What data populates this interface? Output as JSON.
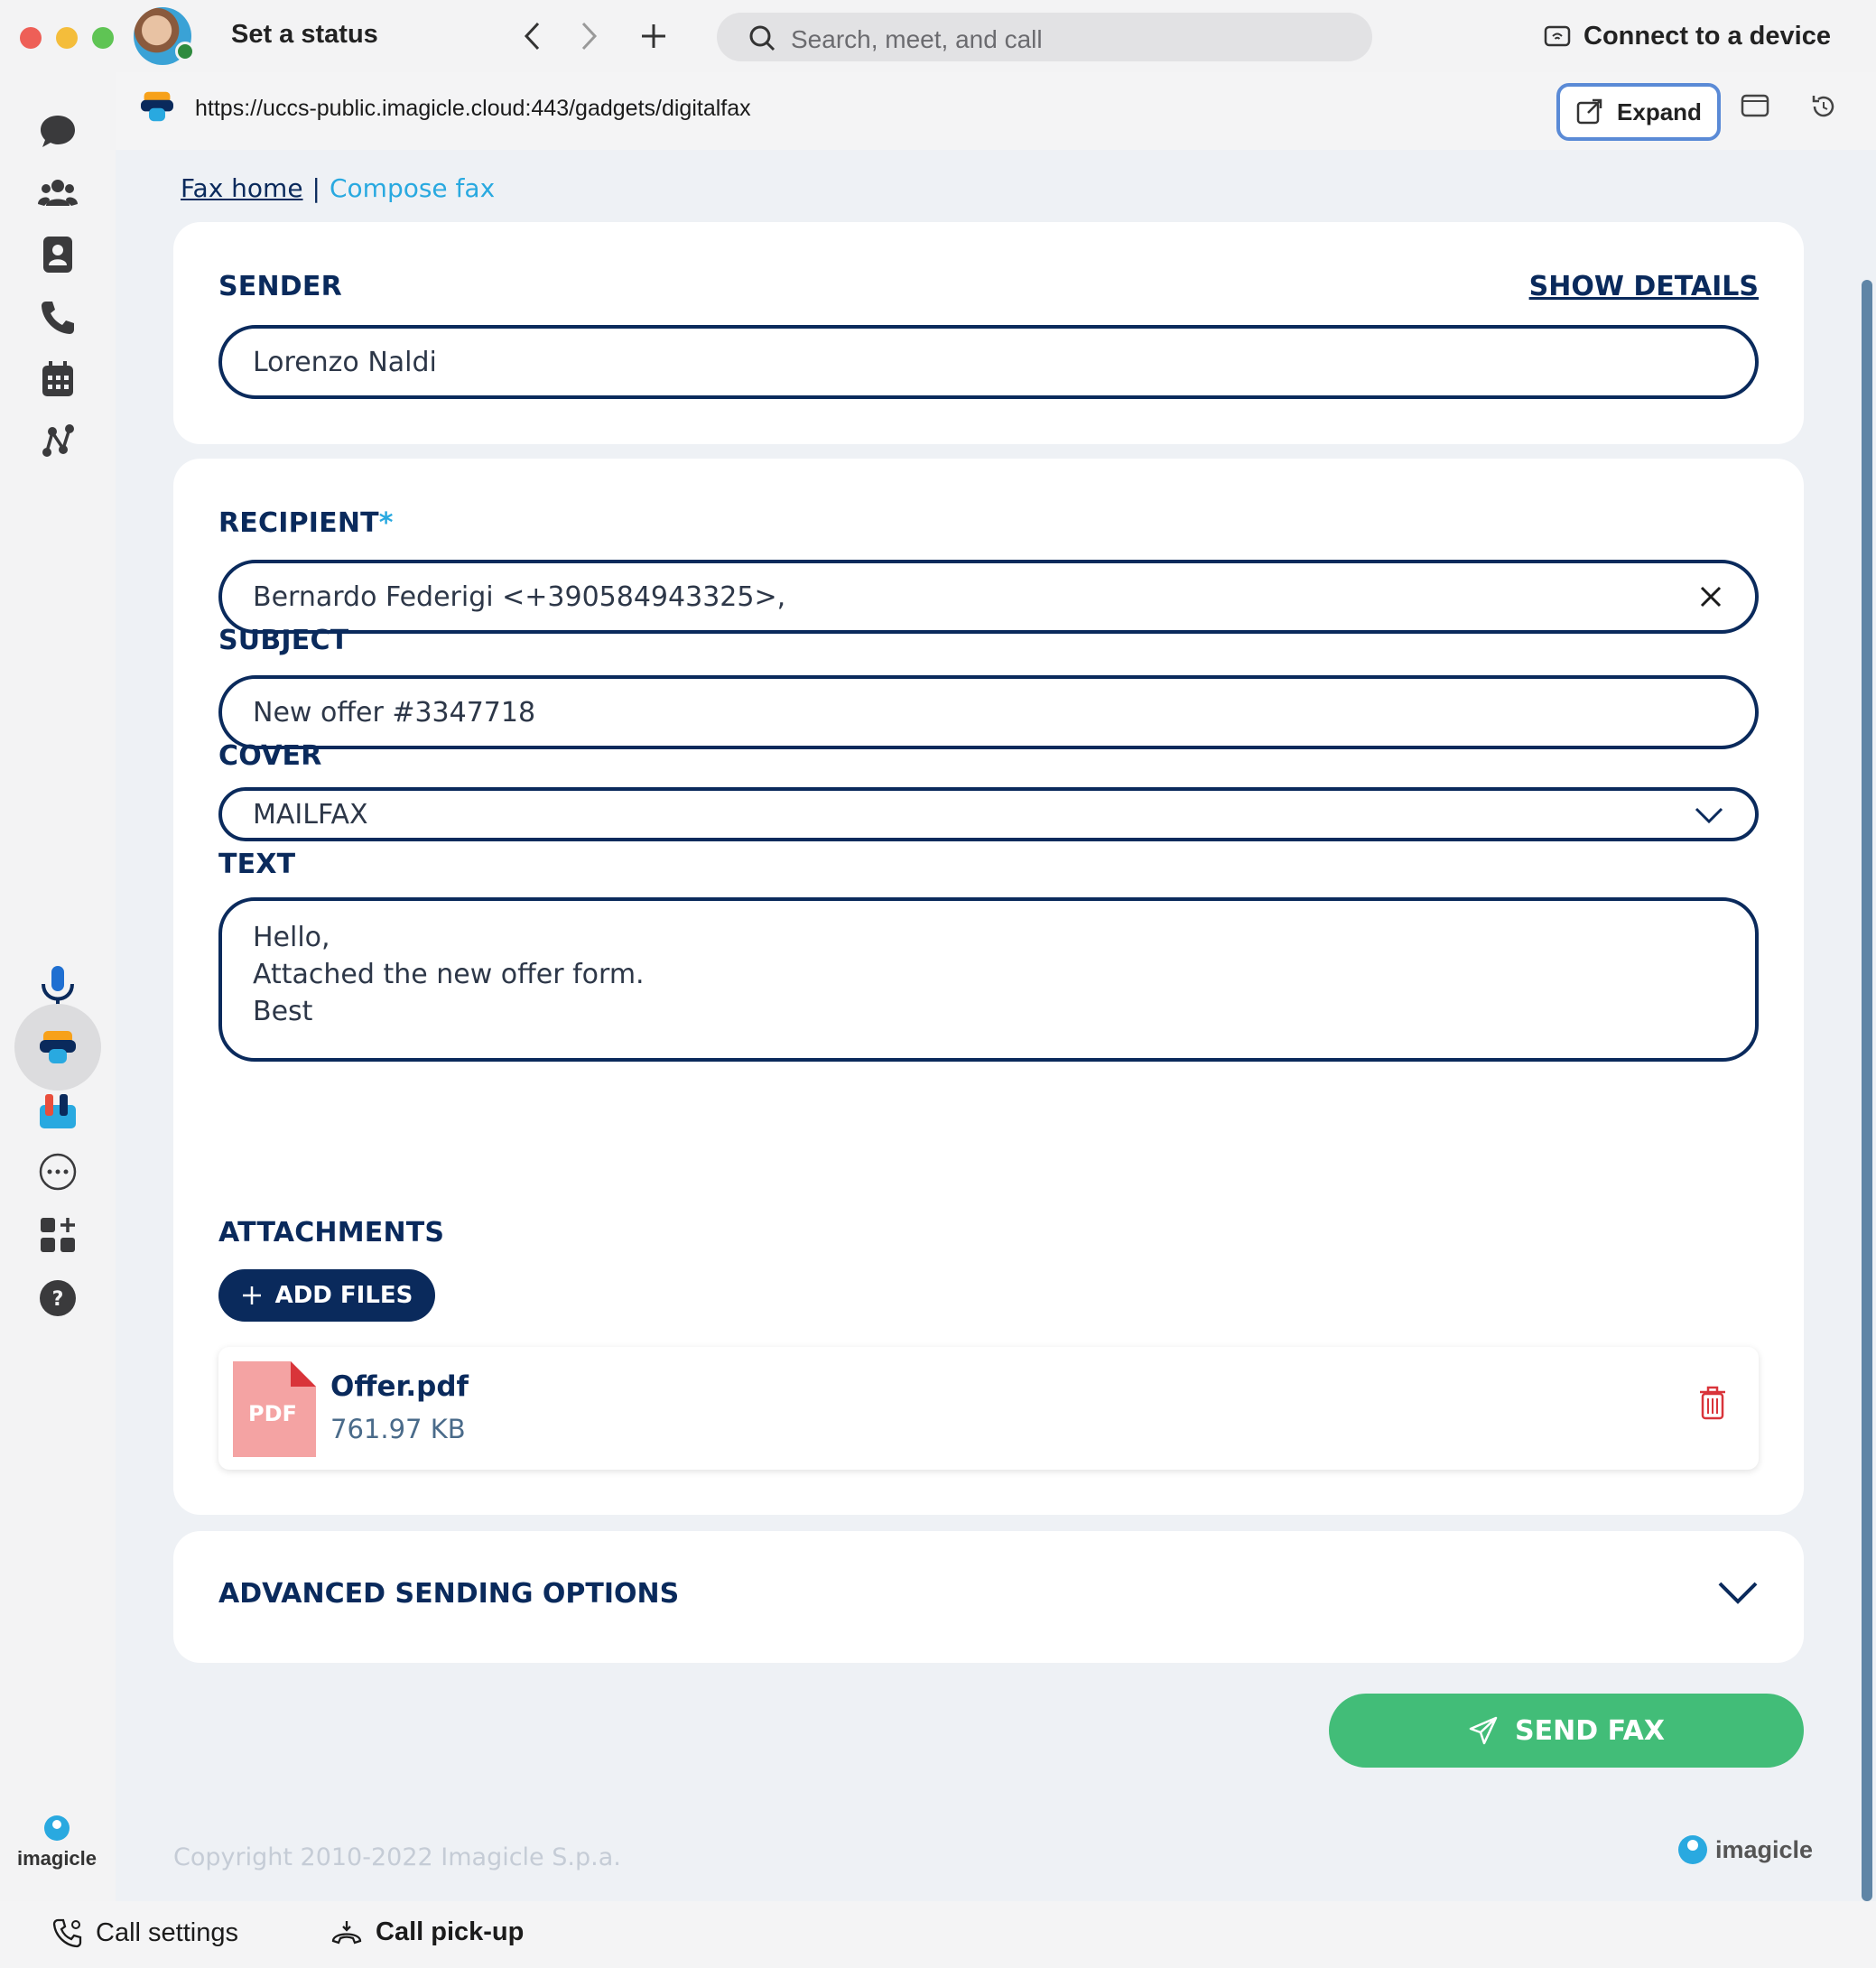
{
  "titlebar": {
    "status": "Set a status",
    "search_placeholder": "Search, meet, and call",
    "connect_label": "Connect to a device"
  },
  "urlbar": {
    "url": "https://uccs-public.imagicle.cloud:443/gadgets/digitalfax",
    "expand_label": "Expand"
  },
  "rail": {
    "items": [
      "chat-icon",
      "teams-icon",
      "contacts-icon",
      "calling-icon",
      "calendar-icon",
      "workflow-icon",
      "microphone-icon",
      "digital-fax-icon",
      "apps-icon",
      "more-icon",
      "add-apps-icon",
      "help-icon"
    ],
    "logo_text": "imagicle"
  },
  "breadcrumb": {
    "home": "Fax home",
    "separator": "|",
    "current": "Compose fax"
  },
  "sender": {
    "label": "SENDER",
    "show_details": "SHOW DETAILS",
    "value": "Lorenzo Naldi"
  },
  "recipient": {
    "label": "RECIPIENT",
    "required_mark": "*",
    "value": "Bernardo Federigi <+390584943325>,"
  },
  "subject": {
    "label": "SUBJECT",
    "value": "New offer #3347718"
  },
  "cover": {
    "label": "COVER",
    "value": "MAILFAX"
  },
  "text": {
    "label": "TEXT",
    "lines": [
      "Hello,",
      "Attached the new offer form.",
      "Best"
    ]
  },
  "attachments": {
    "label": "ATTACHMENTS",
    "add_files": "ADD FILES",
    "files": [
      {
        "badge": "PDF",
        "name": "Offer.pdf",
        "size": "761.97 KB"
      }
    ]
  },
  "advanced": {
    "label": "ADVANCED SENDING OPTIONS"
  },
  "send_label": "SEND FAX",
  "footer": {
    "copyright": "Copyright 2010-2022 Imagicle S.p.a.",
    "brand": "imagicle"
  },
  "bottombar": {
    "call_settings": "Call settings",
    "call_pickup": "Call pick-up"
  },
  "colors": {
    "navy": "#0a2a5c",
    "accent": "#29a9e0",
    "send_green": "#42bd78",
    "danger": "#d9343a"
  }
}
